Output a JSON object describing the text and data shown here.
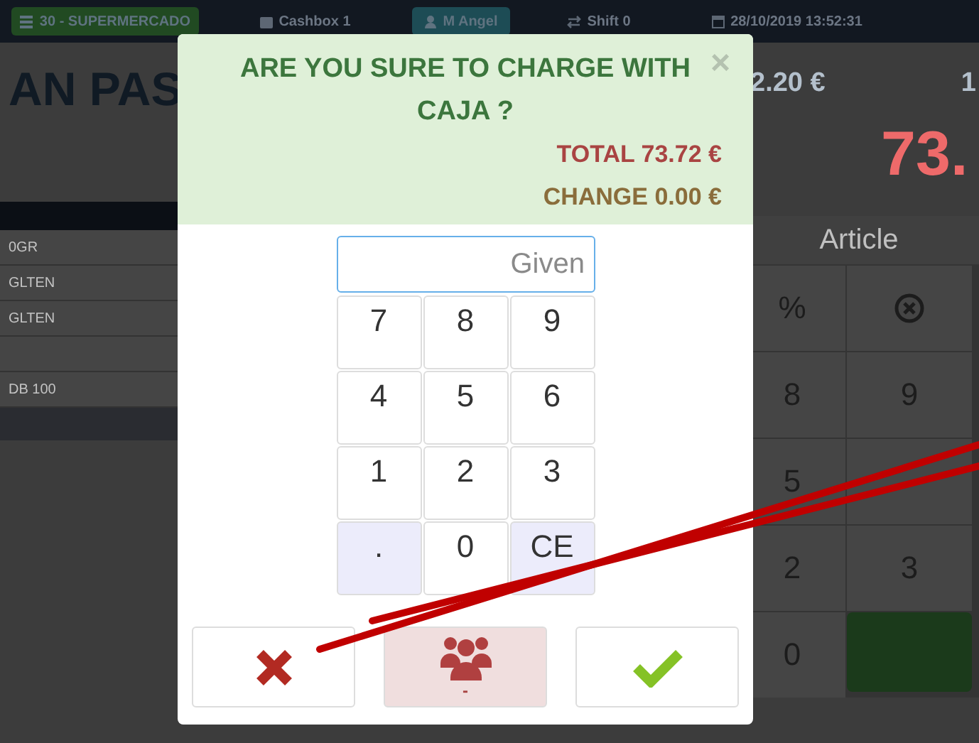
{
  "top_bar": {
    "store": "30 - SUPERMERCADO",
    "cashbox": "Cashbox 1",
    "user": "M Angel",
    "shift": "Shift 0",
    "datetime": "28/10/2019 13:52:31"
  },
  "ticket": {
    "title": "AN PAS",
    "rows": [
      {
        "text": "0GR"
      },
      {
        "text": "GLTEN"
      },
      {
        "text": "GLTEN"
      },
      {},
      {
        "text": "DB 100"
      }
    ]
  },
  "summary": {
    "price": "2.20 €",
    "column_2": "1",
    "total": "73."
  },
  "keypad": {
    "tab": "Article",
    "keys": [
      {
        "kind": "text",
        "label": "%"
      },
      {
        "kind": "icon"
      },
      {
        "kind": "text",
        "label": "8"
      },
      {
        "kind": "text",
        "label": "9"
      },
      {
        "kind": "text",
        "label": "5"
      },
      {
        "kind": "blank"
      },
      {
        "kind": "text",
        "label": "2"
      },
      {
        "kind": "text",
        "label": "3"
      },
      {
        "kind": "text",
        "label": "0"
      },
      {
        "kind": "action"
      }
    ]
  },
  "dialog": {
    "title": "ARE YOU SURE TO CHARGE WITH CAJA ?",
    "close": "×",
    "total": "TOTAL 73.72 €",
    "change": "CHANGE 0.00 €",
    "input": {
      "placeholder": "Given"
    },
    "keys": [
      {
        "kind": "digit",
        "label": "7"
      },
      {
        "kind": "digit",
        "label": "8"
      },
      {
        "kind": "digit",
        "label": "9"
      },
      {
        "kind": "digit",
        "label": "4"
      },
      {
        "kind": "digit",
        "label": "5"
      },
      {
        "kind": "digit",
        "label": "6"
      },
      {
        "kind": "digit",
        "label": "1"
      },
      {
        "kind": "digit",
        "label": "2"
      },
      {
        "kind": "digit",
        "label": "3"
      },
      {
        "kind": "function",
        "label": "."
      },
      {
        "kind": "digit",
        "label": "0"
      },
      {
        "kind": "function",
        "label": "CE"
      }
    ],
    "actions": [
      {
        "kind": "cancel"
      },
      {
        "kind": "customer",
        "label": "-"
      },
      {
        "kind": "confirm"
      }
    ]
  }
}
